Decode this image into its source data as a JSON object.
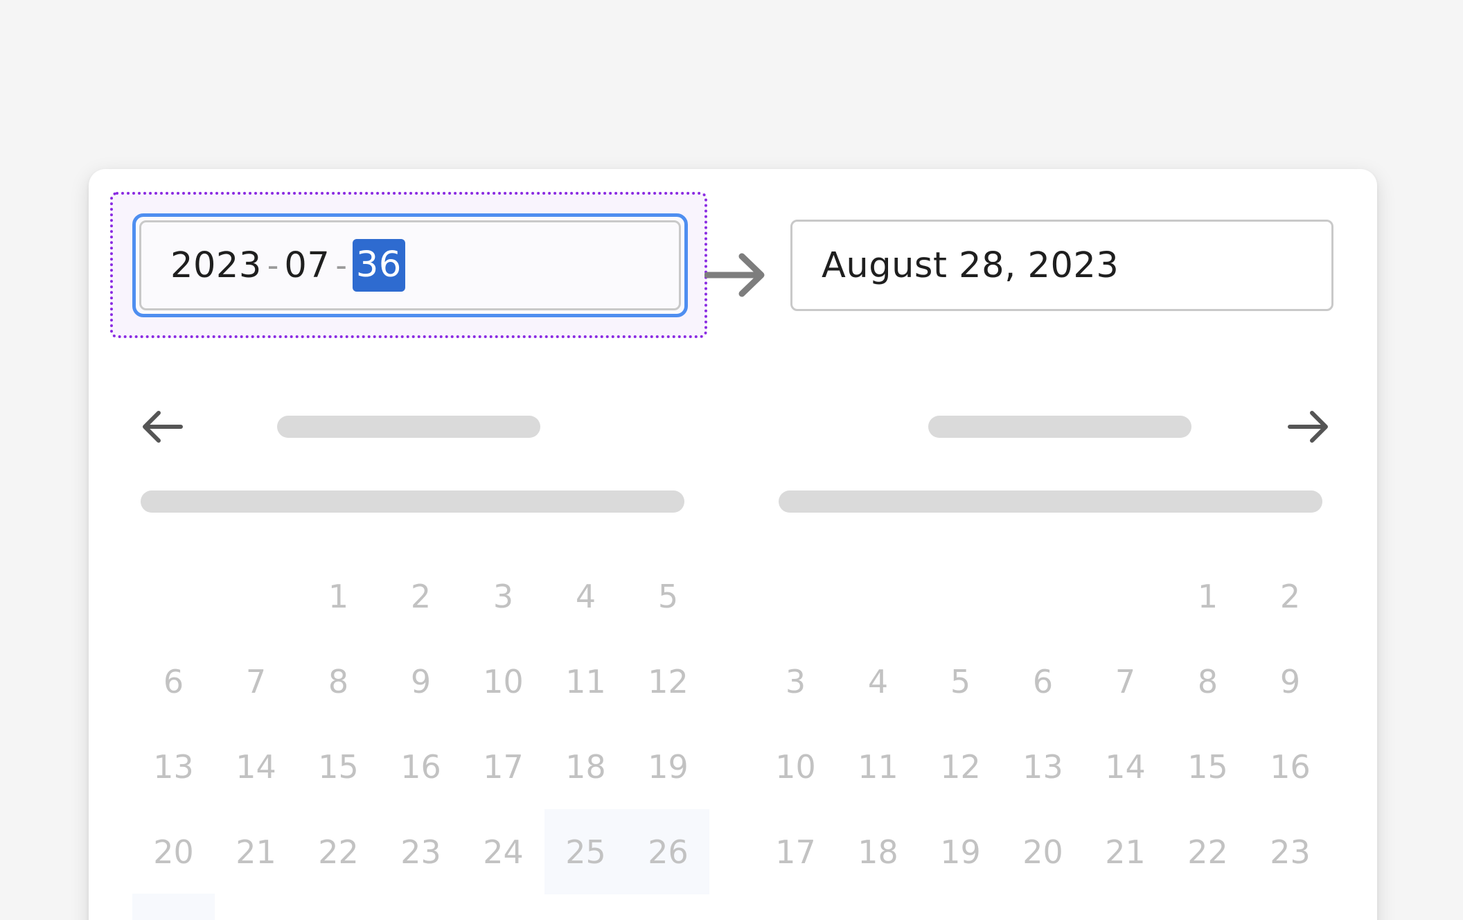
{
  "start_input": {
    "year": "2023",
    "month": "07",
    "day": "36",
    "separator": "-"
  },
  "end_input": {
    "value": "August 28, 2023"
  },
  "icons": {
    "range_arrow": "arrow-right-icon",
    "prev": "arrow-left-icon",
    "next": "arrow-right-icon"
  },
  "colors": {
    "focus_ring": "#8a2be2",
    "input_focus_border": "#4f8ef0",
    "selection": "#2e6bd0",
    "skeleton": "#dadada",
    "day_text": "#c2c2c2"
  },
  "calendar_left": {
    "weeks": [
      [
        "",
        "",
        "1",
        "2",
        "3",
        "4",
        "5"
      ],
      [
        "6",
        "7",
        "8",
        "9",
        "10",
        "11",
        "12"
      ],
      [
        "13",
        "14",
        "15",
        "16",
        "17",
        "18",
        "19"
      ],
      [
        "20",
        "21",
        "22",
        "23",
        "24",
        "25",
        "26"
      ]
    ]
  },
  "calendar_right": {
    "weeks": [
      [
        "",
        "",
        "",
        "",
        "",
        "1",
        "2"
      ],
      [
        "3",
        "4",
        "5",
        "6",
        "7",
        "8",
        "9"
      ],
      [
        "10",
        "11",
        "12",
        "13",
        "14",
        "15",
        "16"
      ],
      [
        "17",
        "18",
        "19",
        "20",
        "21",
        "22",
        "23"
      ]
    ]
  }
}
